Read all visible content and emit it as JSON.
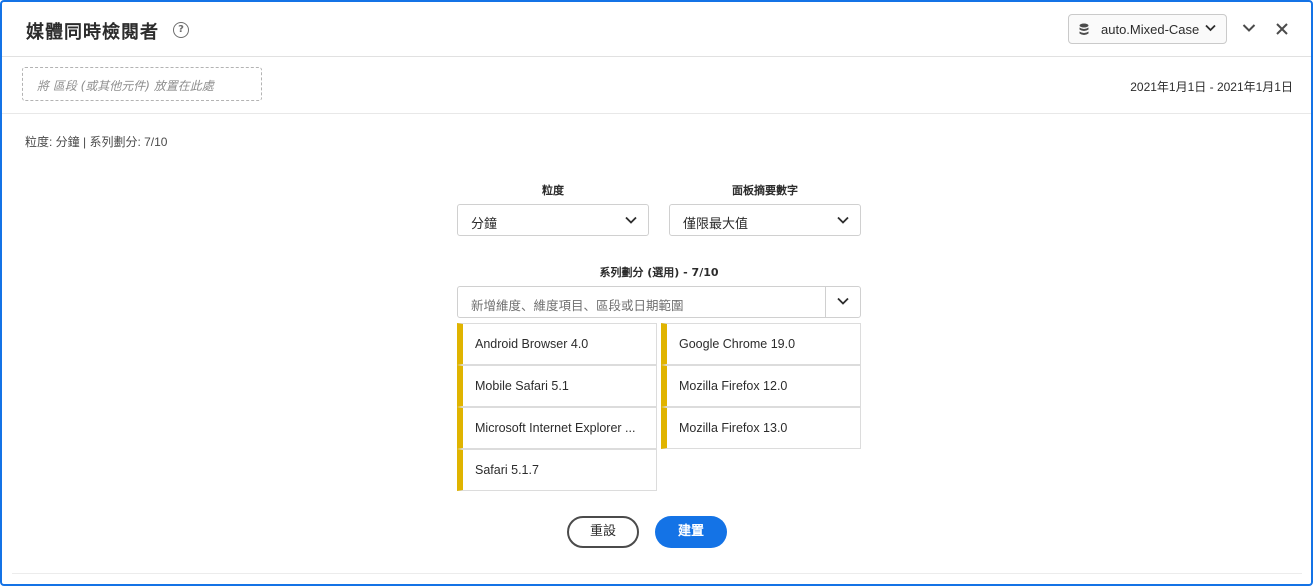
{
  "header": {
    "title": "媒體同時檢閱者",
    "help_icon": "help-circle-icon",
    "datasource_label": "auto.Mixed-Case"
  },
  "dropzone": {
    "placeholder": "將 區段 (或其他元件) 放置在此處"
  },
  "date_range": "2021年1月1日 - 2021年1月1日",
  "summary": "粒度: 分鐘 | 系列劃分: 7/10",
  "settings": {
    "granularity_label": "粒度",
    "granularity_value": "分鐘",
    "panel_summary_label": "面板摘要數字",
    "panel_summary_value": "僅限最大值",
    "breakdown_label": "系列劃分 (選用) - 7/10",
    "breakdown_placeholder": "新增維度、維度項目、區段或日期範圍"
  },
  "breakdown_items": [
    "Android Browser 4.0",
    "Google Chrome 19.0",
    "Mobile Safari 5.1",
    "Mozilla Firefox 12.0",
    "Microsoft Internet Explorer ...",
    "Mozilla Firefox 13.0",
    "Safari 5.1.7"
  ],
  "colors": {
    "accent": "#1473e6",
    "chip_marker": "#e0b400"
  },
  "buttons": {
    "reset": "重設",
    "build": "建置"
  }
}
